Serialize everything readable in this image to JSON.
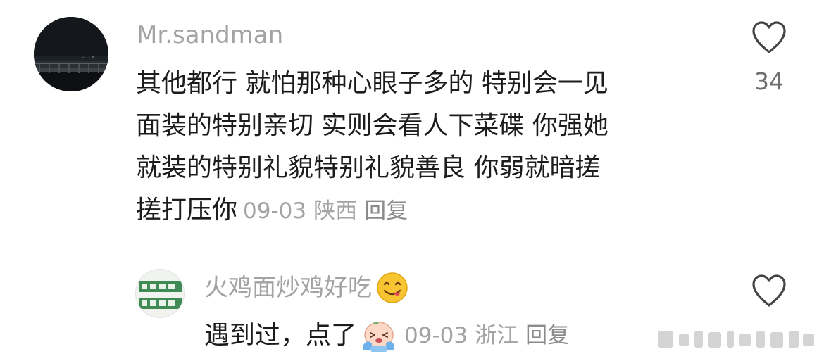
{
  "comments": [
    {
      "username": "Mr.sandman",
      "lines": [
        "其他都行 就怕那种心眼子多的 特别会一见",
        "面装的特别亲切 实则会看人下菜碟 你强她",
        "就装的特别礼貌特别礼貌善良 你弱就暗搓",
        "搓打压你"
      ],
      "date": "09-03",
      "location": "陕西",
      "reply_label": "回复",
      "like_count": "34",
      "like_icon": "heart-outline-icon",
      "avatar": "night-bridge-photo"
    },
    {
      "username": "火鸡面炒鸡好吃",
      "username_emoji": "yum-face-emoji",
      "text": "遇到过，点了",
      "text_emoji": "crying-face-emoji",
      "date": "09-03",
      "location": "浙江",
      "reply_label": "回复",
      "like_icon": "heart-outline-icon",
      "avatar": "green-text-avatar"
    }
  ],
  "colors": {
    "primary_text": "#1c1c1c",
    "secondary_text": "#a3a3a3",
    "like_count": "#6e6e6e",
    "background": "#ffffff"
  }
}
